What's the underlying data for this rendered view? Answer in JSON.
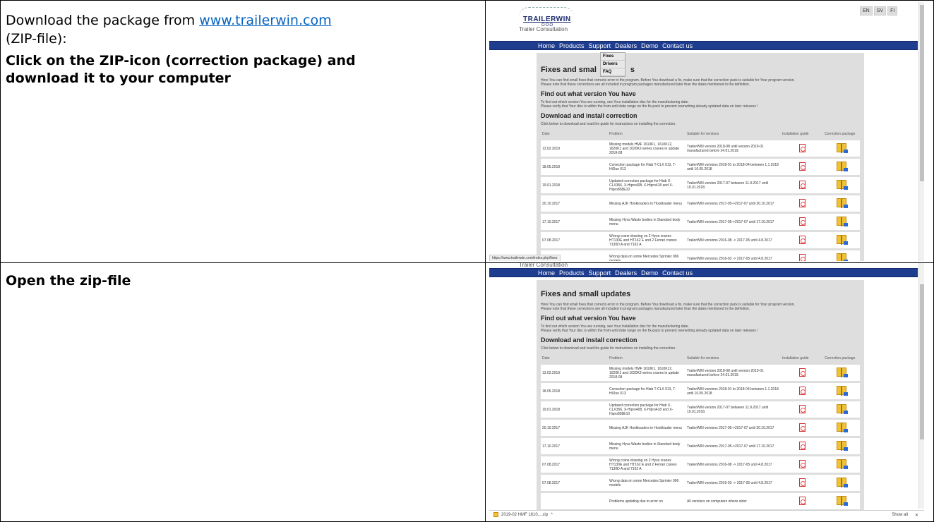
{
  "rows": [
    {
      "text_lines": [
        {
          "pre": "Download the package from ",
          "link": "www.trailerwin.com"
        },
        {
          "plain": "(ZIP-file):"
        }
      ],
      "bold_text": "Click on the ZIP-icon (correction package) and download it to your computer"
    },
    {
      "bold_text": "Open the zip-file"
    }
  ],
  "site": {
    "logo_text": "TRAILERWIN",
    "logo_rings": "OOO",
    "logo_sub": "Trailer Consultation",
    "languages": [
      "EN",
      "SV",
      "FI"
    ],
    "nav": [
      "Home",
      "Products",
      "Support",
      "Dealers",
      "Demo",
      "Contact us"
    ],
    "support_menu": [
      "Fixes",
      "Drivers",
      "FAQ"
    ],
    "title_full": "Fixes and small updates",
    "title_partial_left": "Fixes and smal",
    "title_partial_right": "s",
    "intro": "Here You can find small fixes that corrects error in the program. Before You download a fix, make sure that the correction pack is suitable for Your program version.",
    "intro2": "Please note that these corrections are all included in program packages manufactured later than the dates mentioned in the definition.",
    "h_version": "Find out what version You have",
    "version_text": "To find out which version You are running, see Your installation disc for the manufacturing date.",
    "version_text2": "Please verify that Your disc is within the from-until date range on the fix-pack to prevent overwriting already updated data on later releases !",
    "h_download": "Download and install correction",
    "download_text": "Click below to download and read the guide for instructions on installing the correction.",
    "columns": [
      "Date",
      "Problem",
      "Suitable for versions",
      "Installation guide",
      "Correction package"
    ],
    "fixes": [
      {
        "date": "13.02.2019",
        "problem": "Missing models HMF 1610K1, 1610K12, 1620K1 and 1620K2-series cranes in update 2018-08",
        "versions": "TrailerWIN version 2018-08 until version 2019-01 manufactured before 24.01.2019."
      },
      {
        "date": "18.05.2018",
        "problem": "Correction package for Hiab T-CLX 013, T-HiDuo 013",
        "versions": "TrailerWIN versions 2018-01 to 2018-04 between 1.1.2018 until 16.05.2018"
      },
      {
        "date": "19.01.2018",
        "problem": "Updated correction package for Hiab X-CLX356, X-Hipro408, X-Hipro418 and X-Hipro858E10",
        "versions": "TrailerWIN version 2017-07 between 11.9.2017 until 19.01.2018."
      },
      {
        "date": "20.10.2017",
        "problem": "Missing AJK Hookloaders in Hookloader menu",
        "versions": "TrailerWIN versions 2017-05->2017-07 until 20.10.2017"
      },
      {
        "date": "17.10.2017",
        "problem": "Missing Hyva Waste bodies in Standard body menu",
        "versions": "TrailerWIN versions 2017-05->2017-07 until 17.10.2017"
      },
      {
        "date": "07.08.2017",
        "problem": "Wrong crane drawing on 2 Hyva cranes HT130E and HT162 E and 2 Ferrari cranes 7130D A and 7162 A",
        "versions": "TrailerWIN versions 2016-08 -> 2017-05 until 4.8.2017"
      },
      {
        "date": "07.08.2017",
        "problem": "Wrong data on some Mercedes Sprinter 906 models",
        "versions": "TrailerWIN versions 2016-03 -> 2017-05 until 4.8.2017"
      },
      {
        "date": "",
        "problem": "Problems updating due to error on",
        "versions": "All versions on computers where older"
      }
    ],
    "status_url": "https://www.trailerwin.com/index.php/fixes",
    "download_file": "2019-02 HMF 1610....zip",
    "show_all": "Show all",
    "close_glyph": "✕",
    "caret_glyph": "^"
  }
}
